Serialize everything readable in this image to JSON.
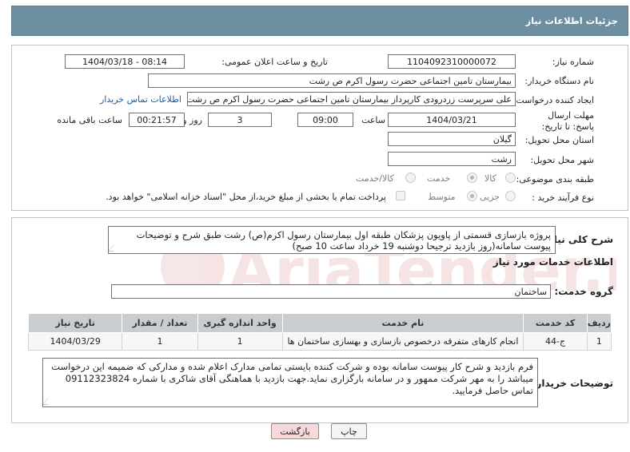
{
  "header": {
    "title": "جزئیات اطلاعات نیاز"
  },
  "fields": {
    "need_number_label": "شماره نیاز:",
    "need_number": "1104092310000072",
    "announce_label": "تاریخ و ساعت اعلان عمومی:",
    "announce_value": "1404/03/18 - 08:14",
    "buyer_org_label": "نام دستگاه خریدار:",
    "buyer_org": "بیمارستان  تامین اجتماعی حضرت رسول اکرم ص رشت",
    "creator_label": "ایجاد کننده درخواست:",
    "creator": "علی سرپرست زردرودی کارپرداز بیمارستان  تامین اجتماعی حضرت رسول اکرم ص رشت",
    "contact_link": "اطلاعات تماس خریدار",
    "deadline_label": "مهلت ارسال پاسخ: تا تاریخ:",
    "deadline_date": "1404/03/21",
    "time_label": "ساعت",
    "deadline_time": "09:00",
    "days_value": "3",
    "days_label": "روز و",
    "remaining_time": "00:21:57",
    "remaining_label": "ساعت باقی مانده",
    "province_label": "استان محل تحویل:",
    "province": "گیلان",
    "city_label": "شهر محل تحویل:",
    "city": "رشت",
    "category_label": "طبقه بندی موضوعی:",
    "category_options": [
      "کالا",
      "خدمت",
      "کالا/خدمت"
    ],
    "category_selected": "خدمت",
    "process_label": "نوع فرآیند خرید :",
    "process_options": [
      "جزیی",
      "متوسط"
    ],
    "process_selected": "متوسط",
    "payment_note": "پرداخت تمام یا بخشی از مبلغ خرید،از محل \"اسناد خزانه اسلامی\" خواهد بود."
  },
  "general": {
    "desc_label": "شرح کلی نیاز:",
    "desc_text": "پروژه بازسازی قسمتی از پاویون پزشکان طبقه اول بیمارستان رسول اکرم(ص) رشت طبق شرح و توضیحات پیوست سامانه(روز بازدید ترجیحا دوشنبه 19 خرداد ساعت 10 صبح)",
    "services_title": "اطلاعات خدمات مورد نیاز",
    "group_label": "گروه خدمت:",
    "group_value": "ساختمان"
  },
  "table": {
    "headers": [
      "ردیف",
      "کد خدمت",
      "نام خدمت",
      "واحد اندازه گیری",
      "تعداد / مقدار",
      "تاریخ نیاز"
    ],
    "rows": [
      [
        "1",
        "ج-44",
        "انجام کارهای متفرقه درخصوص بازسازی و بهسازی ساختمان ها",
        "1",
        "1",
        "1404/03/29"
      ]
    ]
  },
  "buyer_notes": {
    "label": "توضیحات خریدار:",
    "text": "فرم بازدید و شرح کار پیوست سامانه بوده و شرکت کننده بایستی تمامی مدارک اعلام شده و مدارکی که ضمیمه این درخواست میباشد را به مهر شرکت ممهور و در سامانه بارگزاری نماید.جهت بازدید با هماهنگی آقای شاکری با شماره 09112323824 تماس حاصل فرمایید."
  },
  "buttons": {
    "print": "چاپ",
    "back": "بازگشت"
  },
  "watermark": "AriaTender.neT",
  "colors": {
    "header_bg": "#6e8ea1",
    "link": "#1a5fa8",
    "back_btn": "#f7d9d9",
    "table_header": "#c9cdd0"
  }
}
